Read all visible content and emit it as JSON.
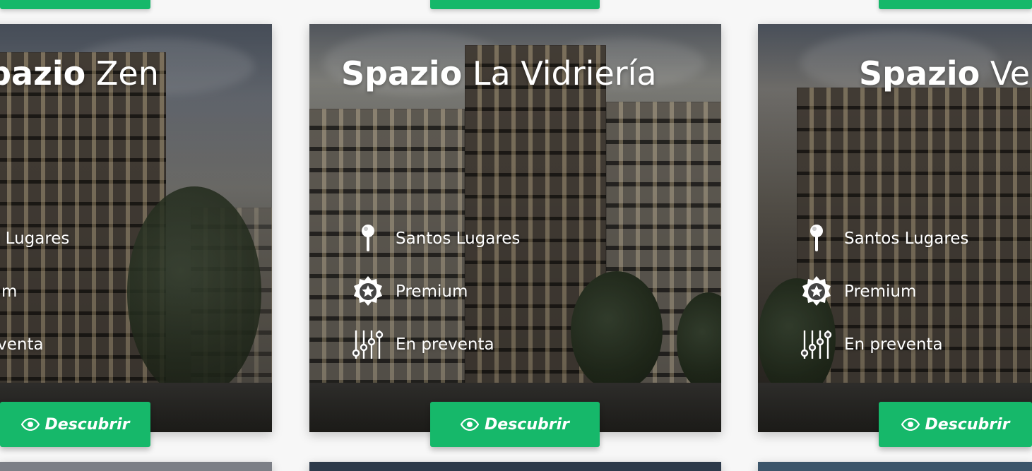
{
  "cards": [
    {
      "brand": "Spazio",
      "name": "Zen",
      "location": "Santos Lugares",
      "category": "Premium",
      "status": "En preventa",
      "cta_label": "Descubrir"
    },
    {
      "brand": "Spazio",
      "name": "La Vidriería",
      "location": "Santos Lugares",
      "category": "Premium",
      "status": "En preventa",
      "cta_label": "Descubrir"
    },
    {
      "brand": "Spazio",
      "name": "Ve",
      "location": "Santos Lugares",
      "category": "Premium",
      "status": "En preventa",
      "cta_label": "Descubrir"
    }
  ],
  "icons": {
    "location": "map-pin-icon",
    "category": "badge-star-icon",
    "status": "sliders-icon",
    "cta": "eye-icon"
  },
  "colors": {
    "accent": "#16b86a",
    "text": "#ffffff",
    "background": "#f7f7f7"
  }
}
